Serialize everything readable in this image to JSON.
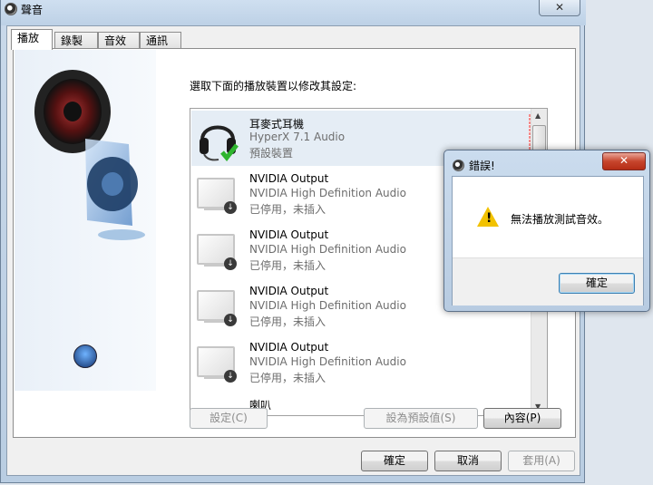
{
  "window": {
    "title": "聲音",
    "close_label": "✕",
    "tabs": [
      {
        "label": "播放"
      },
      {
        "label": "錄製"
      },
      {
        "label": "音效"
      },
      {
        "label": "通訊"
      }
    ],
    "instruction": "選取下面的播放裝置以修改其設定:",
    "devices": [
      {
        "name": "耳麥式耳機",
        "driver": "HyperX 7.1 Audio",
        "status": "預設裝置",
        "icon": "headset-icon",
        "selected": true
      },
      {
        "name": "NVIDIA Output",
        "driver": "NVIDIA High Definition Audio",
        "status": "已停用，未插入",
        "icon": "monitor-icon"
      },
      {
        "name": "NVIDIA Output",
        "driver": "NVIDIA High Definition Audio",
        "status": "已停用，未插入",
        "icon": "monitor-icon"
      },
      {
        "name": "NVIDIA Output",
        "driver": "NVIDIA High Definition Audio",
        "status": "已停用，未插入",
        "icon": "monitor-icon"
      },
      {
        "name": "NVIDIA Output",
        "driver": "NVIDIA High Definition Audio",
        "status": "已停用，未插入",
        "icon": "monitor-icon"
      },
      {
        "name": "喇叭",
        "driver": "",
        "status": "",
        "icon": "speaker-icon"
      }
    ],
    "buttons": {
      "configure": "設定(C)",
      "set_default": "設為預設值(S)",
      "properties": "內容(P)",
      "ok": "確定",
      "cancel": "取消",
      "apply": "套用(A)"
    }
  },
  "error_dialog": {
    "title": "錯誤!",
    "close_label": "✕",
    "message": "無法播放測試音效。",
    "ok": "確定"
  }
}
